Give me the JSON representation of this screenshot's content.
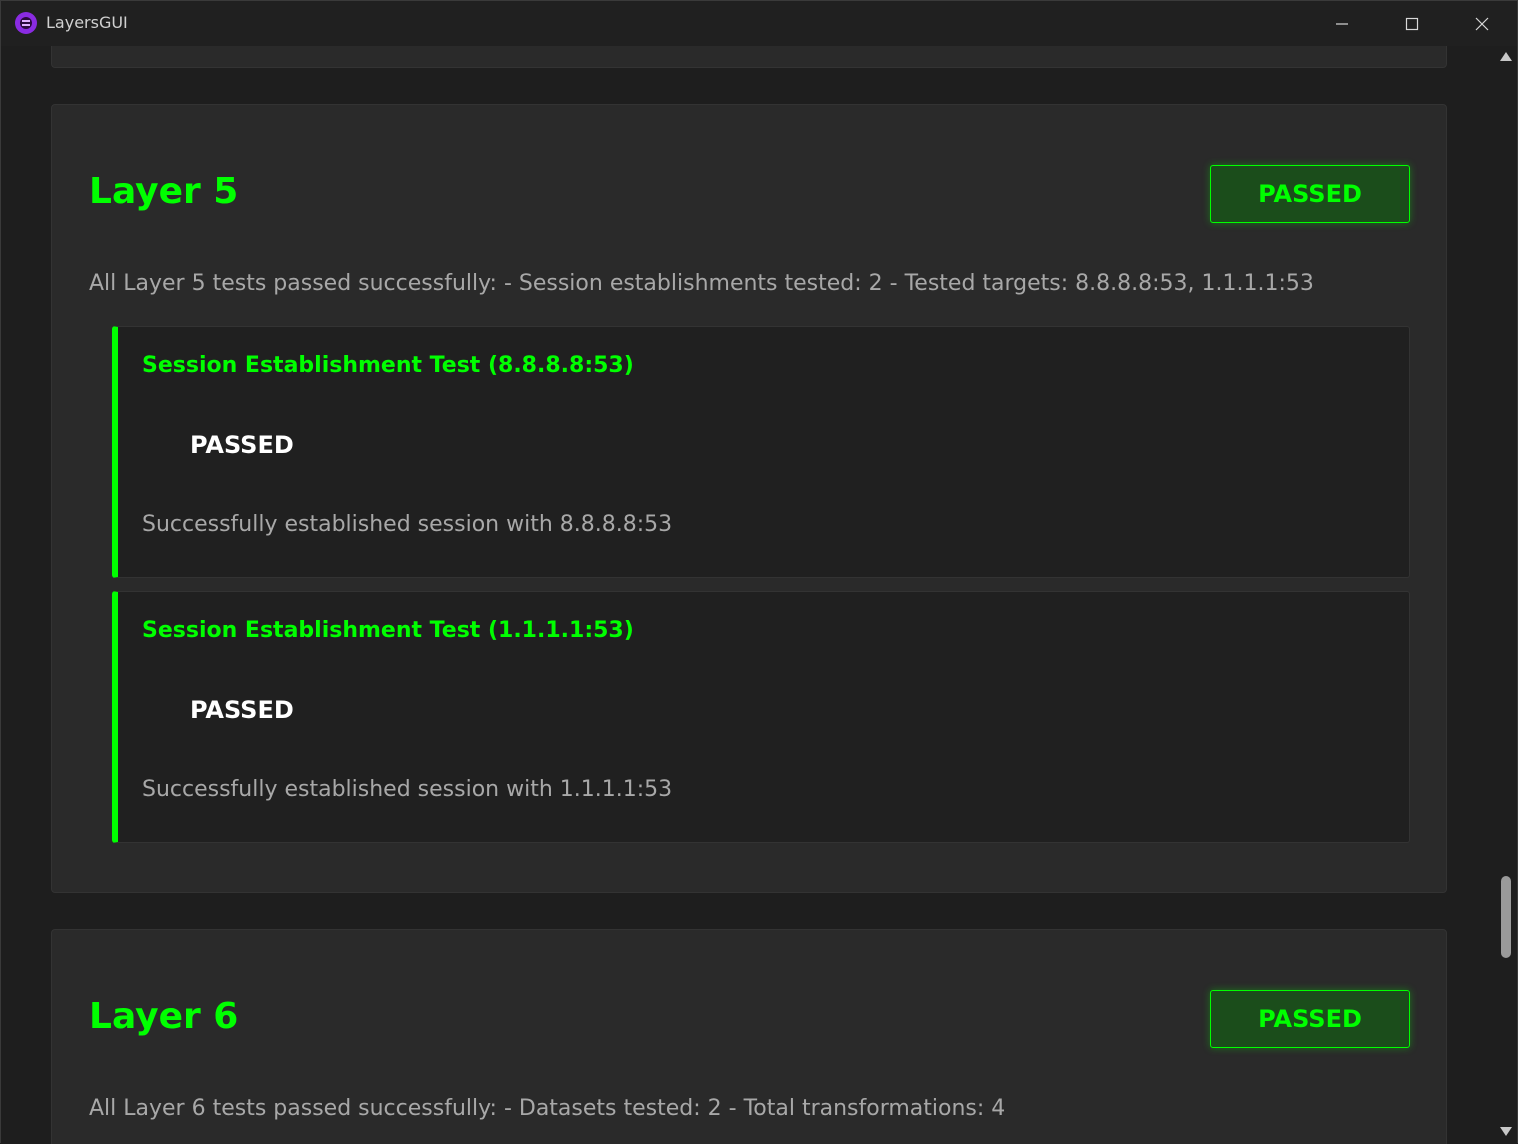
{
  "window": {
    "title": "LayersGUI",
    "icon": "app-icon"
  },
  "layers": [
    {
      "title": "Layer 5",
      "status": "PASSED",
      "summary": "All Layer 5 tests passed successfully: - Session establishments tested: 2 - Tested targets: 8.8.8.8:53, 1.1.1.1:53",
      "tests": [
        {
          "title": "Session Establishment Test (8.8.8.8:53)",
          "status": "PASSED",
          "message": "Successfully established session with 8.8.8.8:53"
        },
        {
          "title": "Session Establishment Test (1.1.1.1:53)",
          "status": "PASSED",
          "message": "Successfully established session with 1.1.1.1:53"
        }
      ]
    },
    {
      "title": "Layer 6",
      "status": "PASSED",
      "summary": "All Layer 6 tests passed successfully: - Datasets tested: 2 - Total transformations: 4"
    }
  ],
  "colors": {
    "accent": "#00ff00",
    "background": "#1e1e1e",
    "card": "#2a2a2a",
    "text_muted": "#a8a8a8"
  }
}
